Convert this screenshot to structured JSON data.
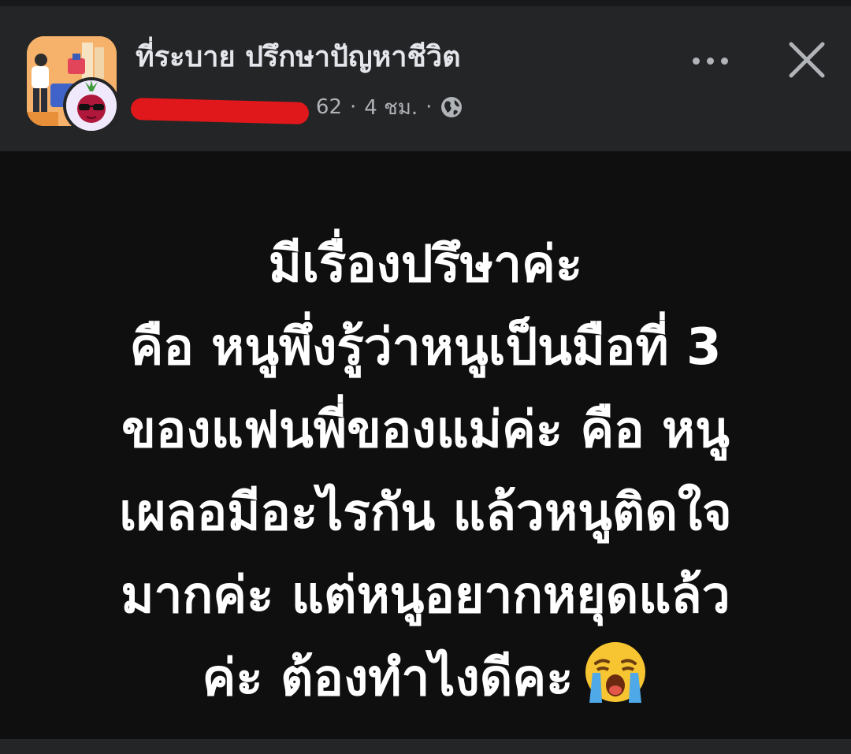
{
  "post": {
    "group_name": "ที่ระบาย ปรึกษาปัญหาชีวิต",
    "author_name_visible": "62",
    "separator": "·",
    "time": "4 ชม.",
    "privacy_icon": "globe-icon",
    "more_icon": "more-options-icon",
    "close_icon": "close-icon",
    "body_lines": [
      "มีเรื่องปรึษาค่ะ",
      "คือ หนูพึ่งรู้ว่าหนูเป็นมือที่ 3",
      "ของแฟนพี่ของแม่ค่ะ คือ หนู",
      "เผลอมีอะไรกัน แล้วหนูติดใจ",
      "มากค่ะ แต่หนูอยากหยุดแล้ว",
      "ค่ะ ต้องทำไงดีคะ"
    ],
    "body_emoji": "crying-face-emoji"
  },
  "colors": {
    "header_bg": "#242526",
    "body_bg": "#0f0f10",
    "text_primary": "#e4e6eb",
    "text_secondary": "#b0b3b8",
    "redaction": "#e0181b"
  }
}
